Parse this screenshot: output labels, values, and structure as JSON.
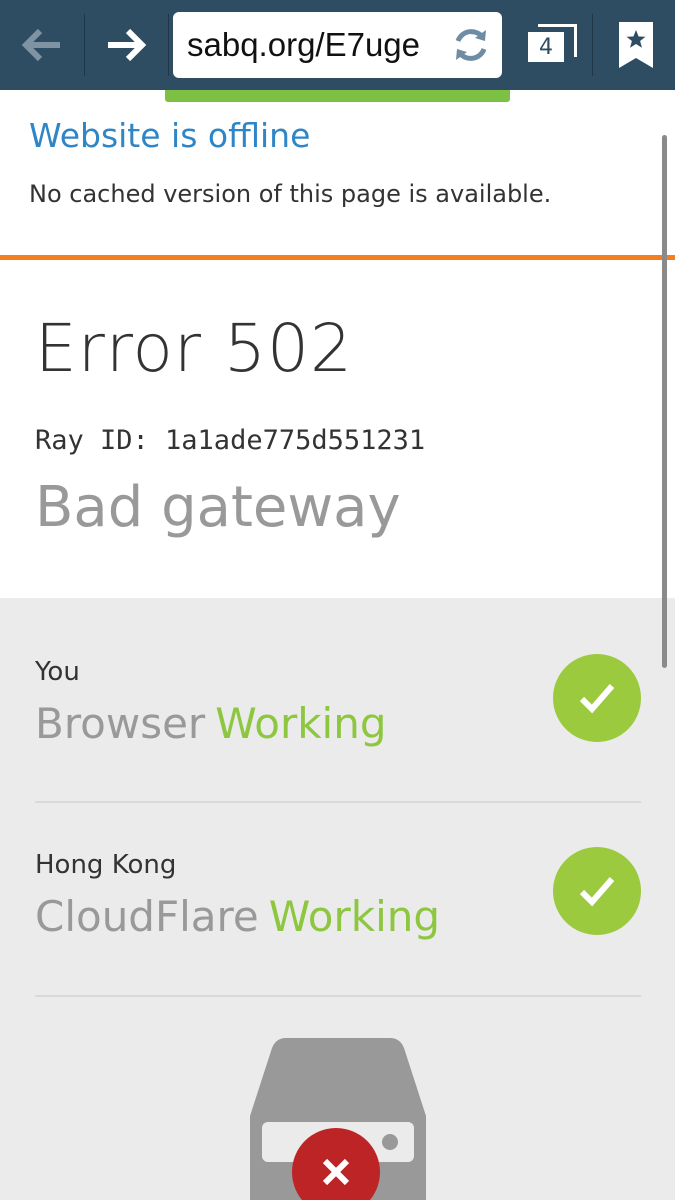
{
  "browser": {
    "url": "sabq.org/E7ugе",
    "tab_count": "4"
  },
  "banner": {
    "title": "Website is offline",
    "subtitle": "No cached version of this page is available."
  },
  "error": {
    "code": "Error 502",
    "ray_id": "Ray ID: 1a1ade775d551231",
    "description": "Bad gateway"
  },
  "status": [
    {
      "label": "You",
      "name": "Browser",
      "state": "Working"
    },
    {
      "label": "Hong Kong",
      "name": "CloudFlare",
      "state": "Working"
    }
  ],
  "colors": {
    "toolbar": "#2e4d63",
    "accent_orange": "#f38020",
    "working_green": "#8dc63f",
    "error_red": "#bd2426",
    "link_blue": "#2f86c7"
  }
}
